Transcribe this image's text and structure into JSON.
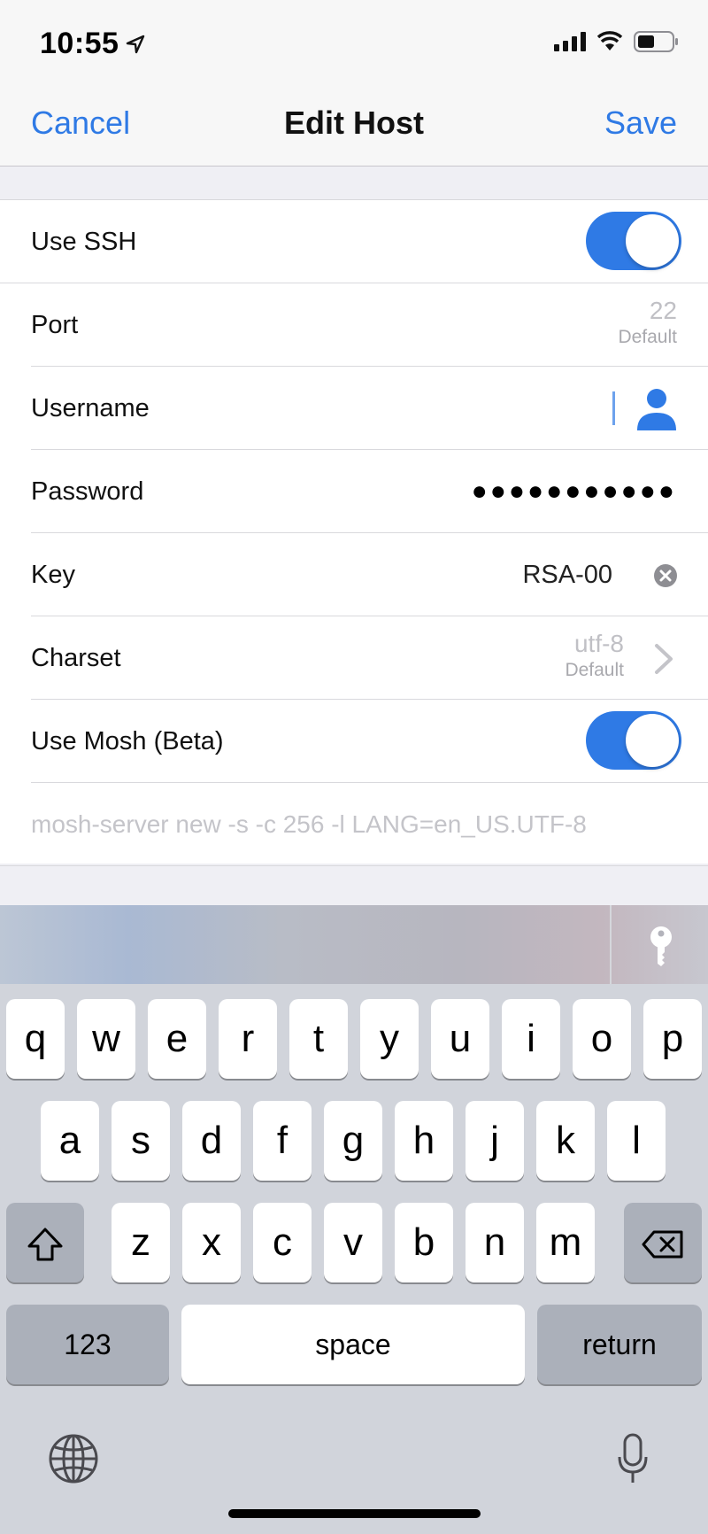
{
  "status_bar": {
    "time": "10:55"
  },
  "nav": {
    "cancel_label": "Cancel",
    "title": "Edit Host",
    "save_label": "Save"
  },
  "form": {
    "use_ssh": {
      "label": "Use SSH",
      "on": true
    },
    "port": {
      "label": "Port",
      "value": "22",
      "hint": "Default"
    },
    "username": {
      "label": "Username",
      "icon": "person-icon"
    },
    "password": {
      "label": "Password",
      "value": "●●●●●●●●●●●"
    },
    "key": {
      "label": "Key",
      "value": "RSA-00",
      "icon": "clear-icon"
    },
    "charset": {
      "label": "Charset",
      "value": "utf-8",
      "hint": "Default",
      "icon": "chevron-right-icon"
    },
    "use_mosh": {
      "label": "Use Mosh (Beta)",
      "on": true
    },
    "mosh_command": {
      "placeholder": "mosh-server new -s -c 256 -l LANG=en_US.UTF-8"
    }
  },
  "keyboard": {
    "row1": [
      "q",
      "w",
      "e",
      "r",
      "t",
      "y",
      "u",
      "i",
      "o",
      "p"
    ],
    "row2": [
      "a",
      "s",
      "d",
      "f",
      "g",
      "h",
      "j",
      "k",
      "l"
    ],
    "row3": [
      "z",
      "x",
      "c",
      "v",
      "b",
      "n",
      "m"
    ],
    "numbers_label": "123",
    "space_label": "space",
    "return_label": "return"
  },
  "colors": {
    "accent": "#2f7ae5",
    "keyboard_bg": "#d1d4db",
    "key_dark": "#abb0ba"
  }
}
